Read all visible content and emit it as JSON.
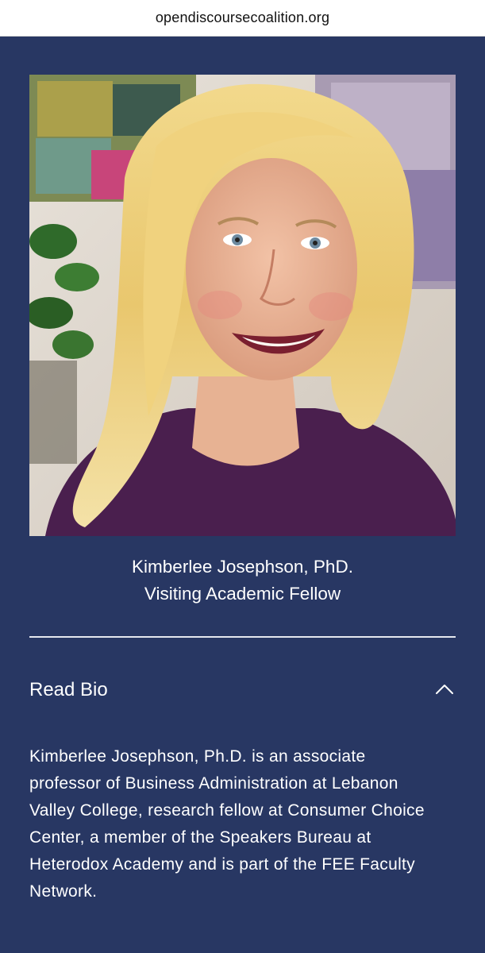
{
  "browser": {
    "url": "opendiscoursecoalition.org"
  },
  "profile": {
    "photo_alt": "Kimberlee Josephson portrait",
    "name": "Kimberlee Josephson, PhD.",
    "role": "Visiting Academic Fellow"
  },
  "bio": {
    "toggle_label": "Read Bio",
    "toggle_icon": "chevron-up-icon",
    "expanded": true,
    "text": "Kimberlee Josephson, Ph.D. is an associate professor of Business Administration at Lebanon Valley College, research fellow at Consumer Choice Center, a member of the Speakers Bureau at Heterodox Academy and is part of the FEE Faculty Network."
  },
  "colors": {
    "page_background": "#283763",
    "text": "#ffffff",
    "divider": "#e6e8ef",
    "urlbar_background": "#ffffff"
  }
}
